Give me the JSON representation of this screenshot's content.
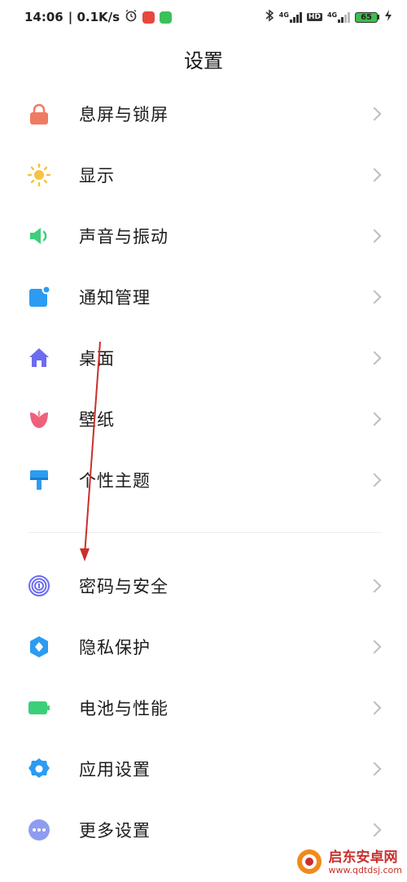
{
  "status": {
    "time": "14:06",
    "speed": "| 0.1K/s",
    "battery": "65",
    "network1": "4G",
    "network2": "4G",
    "hd": "HD"
  },
  "page": {
    "title": "设置"
  },
  "menu": {
    "group1": [
      {
        "label": "息屏与锁屏",
        "icon": "lock-icon",
        "color": "#f07a63"
      },
      {
        "label": "显示",
        "icon": "sun-icon",
        "color": "#f6c343"
      },
      {
        "label": "声音与振动",
        "icon": "speaker-icon",
        "color": "#3ccf7a"
      },
      {
        "label": "通知管理",
        "icon": "notification-icon",
        "color": "#2b9cf2"
      },
      {
        "label": "桌面",
        "icon": "home-icon",
        "color": "#6b6cf0"
      },
      {
        "label": "壁纸",
        "icon": "tulip-icon",
        "color": "#f0607a"
      },
      {
        "label": "个性主题",
        "icon": "brush-icon",
        "color": "#2b9cf2"
      }
    ],
    "group2": [
      {
        "label": "密码与安全",
        "icon": "fingerprint-icon",
        "color": "#6b6cf0"
      },
      {
        "label": "隐私保护",
        "icon": "privacy-shield-icon",
        "color": "#2b9cf2"
      },
      {
        "label": "电池与性能",
        "icon": "battery-icon",
        "color": "#3ccf7a"
      },
      {
        "label": "应用设置",
        "icon": "gear-icon",
        "color": "#2b9cf2"
      },
      {
        "label": "更多设置",
        "icon": "more-icon",
        "color": "#8f9cf0"
      }
    ]
  },
  "watermark": {
    "title": "启东安卓网",
    "url": "www.qdtdsj.com"
  }
}
